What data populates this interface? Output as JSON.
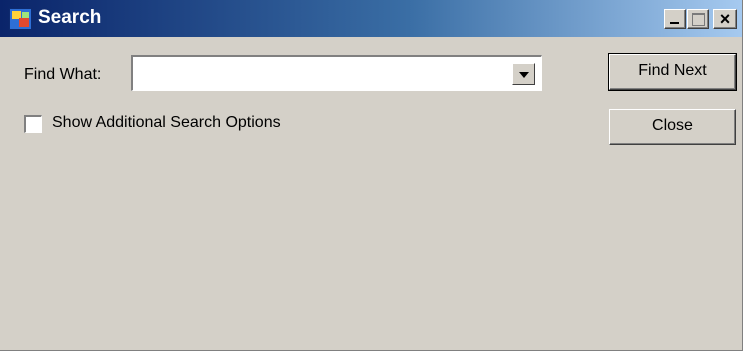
{
  "window": {
    "title": "Search",
    "icon": "application-icon",
    "controls": {
      "minimize": "minimize-icon",
      "maximize": "maximize-icon",
      "close": "×"
    }
  },
  "form": {
    "find_label": "Find What:",
    "find_value": "",
    "options_label": "Show Additional Search Options",
    "options_checked": false
  },
  "buttons": {
    "find_next": "Find Next",
    "close": "Close"
  },
  "colors": {
    "window_bg": "#d4d0c8",
    "title_start": "#0a246a",
    "title_end": "#a6caf0"
  }
}
